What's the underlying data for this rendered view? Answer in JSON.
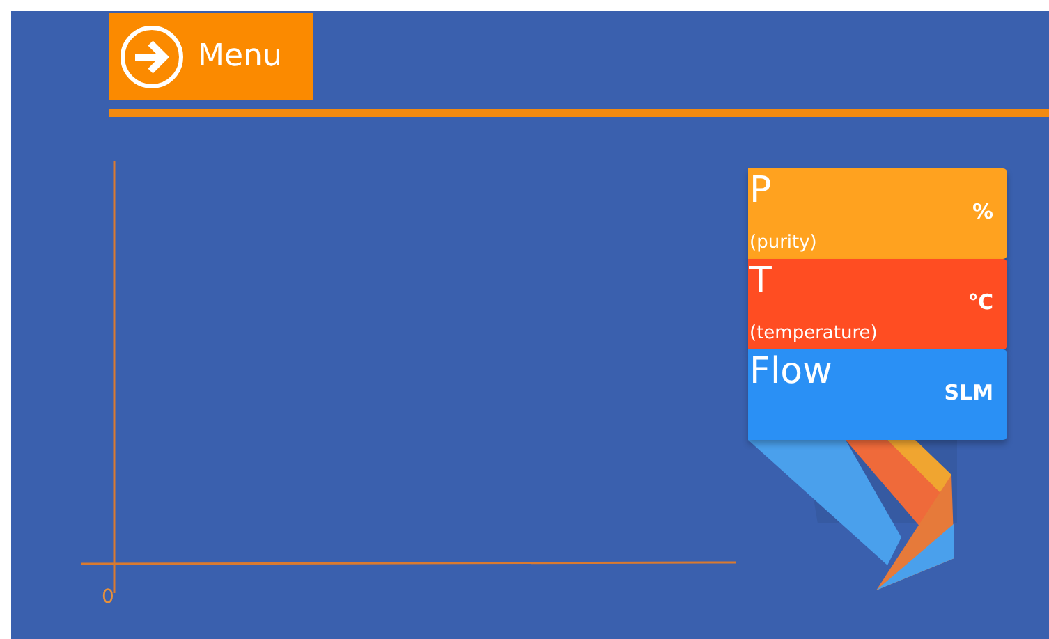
{
  "menu_button": {
    "label": "Menu"
  },
  "chart": {
    "axis_label": "0"
  },
  "legend": [
    {
      "symbol": "P",
      "description": "(purity)",
      "unit": "%",
      "color": "#ffa21f"
    },
    {
      "symbol": "T",
      "description": "(temperature)",
      "unit": "℃",
      "color": "#ff4d22"
    },
    {
      "symbol": "Flow",
      "unit": "SLM",
      "color": "#2a90f5"
    }
  ]
}
